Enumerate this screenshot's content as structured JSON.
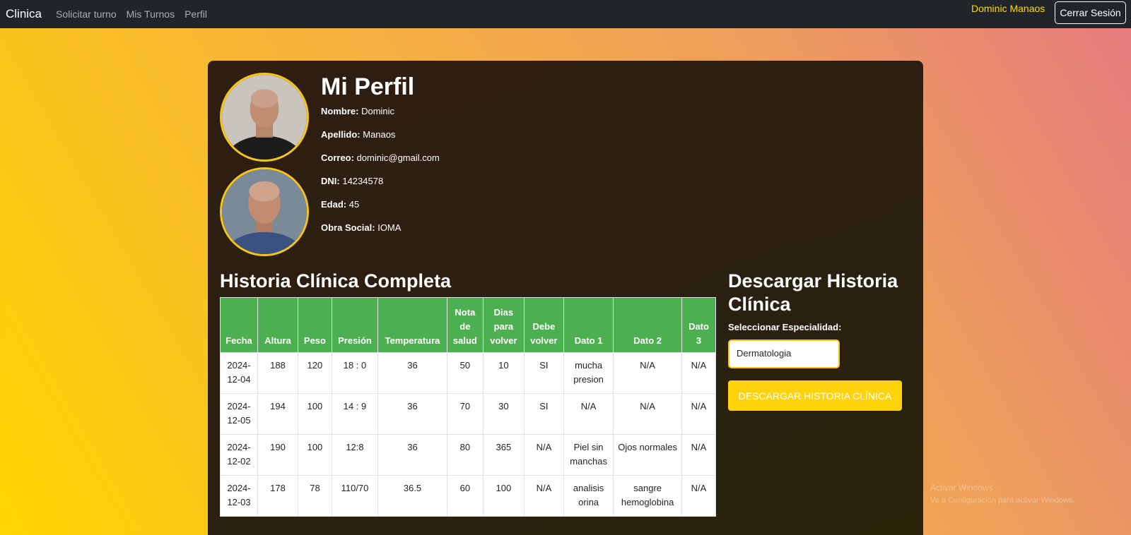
{
  "navbar": {
    "brand": "Clinica",
    "links": [
      "Solicitar turno",
      "Mis Turnos",
      "Perfil"
    ],
    "user_name": "Dominic Manaos",
    "logout_label": "Cerrar Sesión"
  },
  "profile": {
    "title": "Mi Perfil",
    "fields": [
      {
        "label": "Nombre:",
        "value": "Dominic"
      },
      {
        "label": "Apellido:",
        "value": "Manaos"
      },
      {
        "label": "Correo:",
        "value": "dominic@gmail.com"
      },
      {
        "label": "DNI:",
        "value": "14234578"
      },
      {
        "label": "Edad:",
        "value": "45"
      },
      {
        "label": "Obra Social:",
        "value": "IOMA"
      }
    ]
  },
  "history": {
    "title": "Historia Clínica Completa",
    "headers": [
      "Fecha",
      "Altura",
      "Peso",
      "Presión",
      "Temperatura",
      "Nota de salud",
      "Dias para volver",
      "Debe volver",
      "Dato 1",
      "Dato 2",
      "Dato 3"
    ],
    "rows": [
      [
        "2024-12-04",
        "188",
        "120",
        "18 : 0",
        "36",
        "50",
        "10",
        "SI",
        "mucha presion",
        "N/A",
        "N/A"
      ],
      [
        "2024-12-05",
        "194",
        "100",
        "14 : 9",
        "36",
        "70",
        "30",
        "SI",
        "N/A",
        "N/A",
        "N/A"
      ],
      [
        "2024-12-02",
        "190",
        "100",
        "12:8",
        "36",
        "80",
        "365",
        "N/A",
        "Piel sin manchas",
        "Ojos normales",
        "N/A"
      ],
      [
        "2024-12-03",
        "178",
        "78",
        "110/70",
        "36.5",
        "60",
        "100",
        "N/A",
        "analisis orina",
        "sangre hemoglobina",
        "N/A"
      ]
    ]
  },
  "download": {
    "title": "Descargar Historia Clínica",
    "select_label": "Seleccionar Especialidad:",
    "selected": "Dermatologia",
    "button_label": "DESCARGAR HISTORIA CLÍNICA"
  },
  "watermark": {
    "line1": "Activar Windows",
    "line2": "Ve a Configuración para activar Windows."
  },
  "colors": {
    "navbar": "#212529",
    "accent_yellow": "#ffd20a",
    "table_header": "#4caf50"
  }
}
